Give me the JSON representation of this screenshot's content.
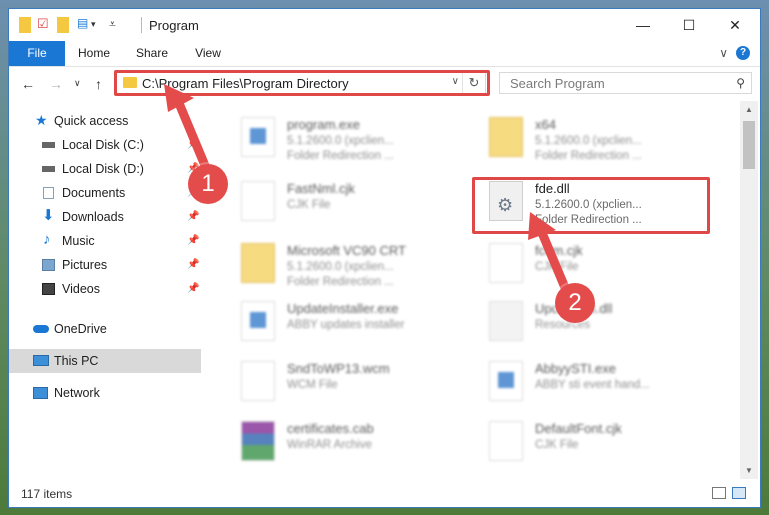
{
  "window": {
    "title": "Program",
    "minimize": "—",
    "maximize": "☐",
    "close": "✕"
  },
  "ribbon": {
    "tabs": [
      "File",
      "Home",
      "Share",
      "View"
    ],
    "expand": "∨",
    "help": "?"
  },
  "nav": {
    "back": "←",
    "forward": "→",
    "recent": "∨",
    "up": "↑",
    "address": "C:\\Program Files\\Program Directory",
    "address_dropdown": "∨",
    "refresh": "↻",
    "search_placeholder": "Search Program",
    "search_icon": "⚲"
  },
  "sidebar": {
    "items": [
      {
        "label": "Quick access",
        "icon": "star-icon",
        "pinned": false
      },
      {
        "label": "Local Disk (C:)",
        "icon": "drive-icon",
        "pinned": true
      },
      {
        "label": "Local Disk (D:)",
        "icon": "drive-icon",
        "pinned": true
      },
      {
        "label": "Documents",
        "icon": "documents-icon",
        "pinned": true
      },
      {
        "label": "Downloads",
        "icon": "download-icon",
        "pinned": true
      },
      {
        "label": "Music",
        "icon": "music-icon",
        "pinned": true
      },
      {
        "label": "Pictures",
        "icon": "pictures-icon",
        "pinned": true
      },
      {
        "label": "Videos",
        "icon": "videos-icon",
        "pinned": true
      },
      {
        "label": "OneDrive",
        "icon": "cloud-icon",
        "pinned": false
      },
      {
        "label": "This PC",
        "icon": "computer-icon",
        "pinned": false,
        "selected": true
      },
      {
        "label": "Network",
        "icon": "network-icon",
        "pinned": false
      }
    ],
    "pin_glyph": "📌"
  },
  "files": [
    {
      "name": "program.exe",
      "line1": "5.1.2600.0 (xpclien...",
      "line2": "Folder Redirection ...",
      "icon": "exe-icon"
    },
    {
      "name": "x64",
      "line1": "5.1.2600.0 (xpclien...",
      "line2": "Folder Redirection ...",
      "icon": "folder-icon"
    },
    {
      "name": "FastNml.cjk",
      "line1": "CJK File",
      "line2": "",
      "icon": "file-icon"
    },
    {
      "name": "fde.dll",
      "line1": "5.1.2600.0 (xpclien...",
      "line2": "Folder Redirection ...",
      "icon": "dll-icon"
    },
    {
      "name": "Microsoft VC90 CRT",
      "line1": "5.1.2600.0 (xpclien...",
      "line2": "Folder Redirection ...",
      "icon": "folder-icon"
    },
    {
      "name": "fcom.cjk",
      "line1": "CJK File",
      "line2": "",
      "icon": "file-icon"
    },
    {
      "name": "UpdateInstaller.exe",
      "line1": "ABBY updates installer",
      "line2": "",
      "icon": "exe-icon"
    },
    {
      "name": "Updater63.dll",
      "line1": "Resources",
      "line2": "",
      "icon": "dll-icon"
    },
    {
      "name": "SndToWP13.wcm",
      "line1": "WCM File",
      "line2": "",
      "icon": "file-icon"
    },
    {
      "name": "AbbyySTI.exe",
      "line1": "ABBY sti event hand...",
      "line2": "",
      "icon": "exe-icon"
    },
    {
      "name": "certificates.cab",
      "line1": "WinRAR Archive",
      "line2": "",
      "icon": "archive-icon"
    },
    {
      "name": "DefaultFont.cjk",
      "line1": "CJK File",
      "line2": "",
      "icon": "file-icon"
    }
  ],
  "status": {
    "count": "117 items"
  },
  "callouts": {
    "one": "1",
    "two": "2"
  },
  "colors": {
    "accent": "#1a78d4",
    "highlight": "#e04848",
    "callout": "#e44c4c",
    "folder": "#f5c842"
  }
}
